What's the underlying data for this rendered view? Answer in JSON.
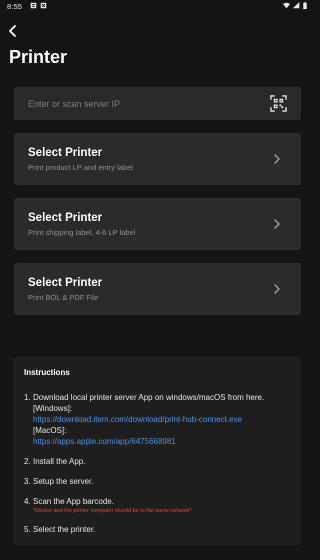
{
  "status_bar": {
    "time": "8:55",
    "left_icons": [
      "notification-icon",
      "gallery-icon"
    ],
    "right_icons": [
      "wifi-icon",
      "signal-icon",
      "battery-icon"
    ]
  },
  "header": {
    "back_icon": "chevron-left-icon",
    "title": "Printer"
  },
  "search": {
    "placeholder": "Enter or scan server IP",
    "value": "",
    "scan_icon": "qr-scan-icon"
  },
  "printers": [
    {
      "title": "Select Printer",
      "subtitle": "Print product LP and entry label"
    },
    {
      "title": "Select Printer",
      "subtitle": "Print shipping label, 4-6 LP label"
    },
    {
      "title": "Select Printer",
      "subtitle": "Print BOL & PDF File"
    }
  ],
  "instructions": {
    "title": "Instructions",
    "steps": [
      {
        "num": "1.",
        "text": "Download local printer server App on windows/macOS from here.",
        "windows_label": "[Windows]:",
        "windows_link": "https://download.item.com/download/print-hub-connect.exe",
        "mac_label": "[MacOS]:",
        "mac_link": "https://apps.apple.com/app/6475668981"
      },
      {
        "num": "2.",
        "text": "Install the App."
      },
      {
        "num": "3.",
        "text": "Setup the server."
      },
      {
        "num": "4.",
        "text": "Scan the App barcode.",
        "note": "*Device and the printer computer should be in the same network*"
      },
      {
        "num": "5.",
        "text": "Select the printer."
      }
    ]
  },
  "colors": {
    "background": "#141414",
    "card": "#2b2b2b",
    "link": "#4a90e2",
    "note": "#e0463d"
  }
}
